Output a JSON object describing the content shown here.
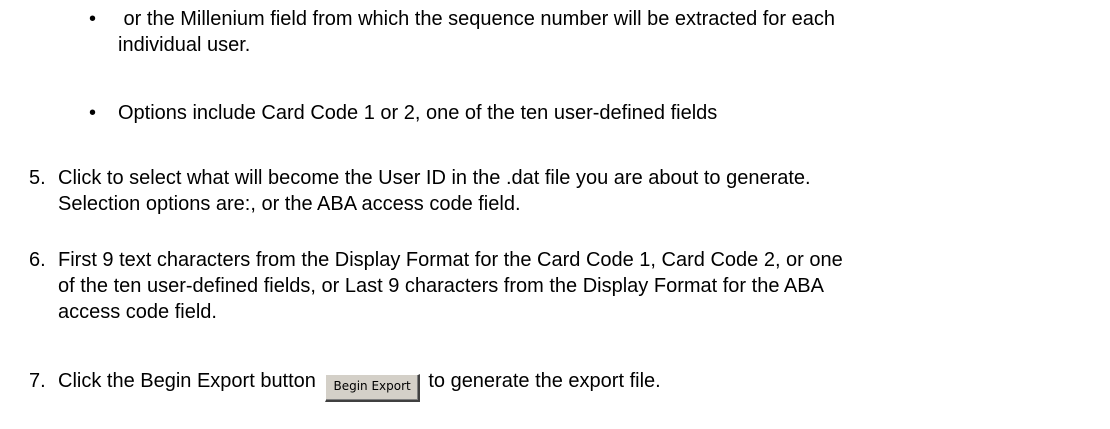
{
  "bullets": [
    {
      "symbol": "•",
      "lines": [
        " or the Millenium field from which the sequence number will be extracted for each",
        "individual user."
      ]
    },
    {
      "symbol": "•",
      "lines": [
        "Options include Card Code 1 or 2, one of the ten user-defined fields"
      ]
    }
  ],
  "steps": [
    {
      "number": "5.",
      "lines": [
        "Click to select what will become the User ID in the .dat file you are about to generate.",
        "Selection options are:, or the ABA access code field."
      ]
    },
    {
      "number": "6.",
      "lines": [
        "First 9 text characters from the Display Format for the Card Code 1, Card Code 2, or one",
        "of the ten user-defined fields, or Last 9 characters from the Display Format for the ABA",
        "access code field."
      ]
    },
    {
      "number": "7.",
      "text_before": "Click the Begin Export button",
      "button_label": "Begin Export",
      "text_after": "to generate the export file."
    }
  ]
}
